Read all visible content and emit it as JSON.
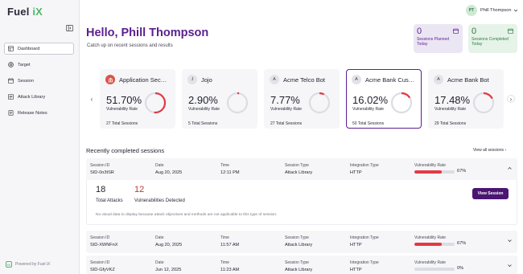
{
  "app": {
    "logo_text": "Fuel",
    "logo_suffix": "iX",
    "powered_by": "Powered by Fuel iX"
  },
  "sidebar": {
    "items": [
      {
        "label": "Dashboard",
        "icon": "dashboard-icon",
        "active": true
      },
      {
        "label": "Target",
        "icon": "target-icon"
      },
      {
        "label": "Session",
        "icon": "calendar-icon"
      },
      {
        "label": "Attack Library",
        "icon": "library-icon"
      },
      {
        "label": "Release Notes",
        "icon": "notes-icon"
      }
    ]
  },
  "user": {
    "initials": "PT",
    "name": "Phill Thompson"
  },
  "header": {
    "greeting": "Hello, Phill Thompson",
    "subtitle": "Catch up on recent sessions and results"
  },
  "stats": {
    "planned": {
      "value": "0",
      "label_line1": "Sessions Planned",
      "label_line2": "Today"
    },
    "completed": {
      "value": "0",
      "label_line1": "Sessions Completed",
      "label_line2": "Today"
    }
  },
  "targets": [
    {
      "name": "Application Securi...",
      "avatar": "bank-icon",
      "rate": "51.70%",
      "rate_value": 51.7,
      "rate_label": "Vulnerability Rate",
      "sessions": "27 Total Sessions",
      "selected": false
    },
    {
      "name": "Jojo",
      "avatar": "J",
      "rate": "2.90%",
      "rate_value": 2.9,
      "rate_label": "Vulnerability Rate",
      "sessions": "5 Total Sessions",
      "selected": false
    },
    {
      "name": "Acme Telco Bot",
      "avatar": "A",
      "rate": "7.77%",
      "rate_value": 7.77,
      "rate_label": "Vulnerability Rate",
      "sessions": "27 Total Sessions",
      "selected": false
    },
    {
      "name": "Acme Bank Custo...",
      "avatar": "A",
      "rate": "16.02%",
      "rate_value": 16.02,
      "rate_label": "Vulnerability Rate",
      "sessions": "50 Total Sessions",
      "selected": true
    },
    {
      "name": "Acme Bank Bot",
      "avatar": "A",
      "rate": "17.48%",
      "rate_value": 17.48,
      "rate_label": "Vulnerability Rate",
      "sessions": "29 Total Sessions",
      "selected": false
    }
  ],
  "recent": {
    "title": "Recently completed sessions",
    "view_all": "View all sessions ›",
    "headers": {
      "id": "Session ID",
      "date": "Date",
      "time": "Time",
      "type": "Session Type",
      "integration": "Integration Type",
      "rate": "Vulnerability Rate"
    },
    "rows": [
      {
        "id": "SID-0n3tSR",
        "date": "Aug 20, 2025",
        "time": "12:11 PM",
        "type": "Attack Library",
        "integration": "HTTP",
        "rate_pct": "67%",
        "rate_value": 67
      },
      {
        "id": "SID-XWNFnX",
        "date": "Aug 20, 2025",
        "time": "11:57 AM",
        "type": "Attack Library",
        "integration": "HTTP",
        "rate_pct": "67%",
        "rate_value": 67
      },
      {
        "id": "SID-GfyVKZ",
        "date": "Jun 12, 2025",
        "time": "11:23 AM",
        "type": "Attack Library",
        "integration": "HTTP",
        "rate_pct": "0%",
        "rate_value": 0
      }
    ],
    "expanded": {
      "attacks_value": "18",
      "attacks_label": "Total Attacks",
      "vulns_value": "12",
      "vulns_label": "Vulnerabilities Detected",
      "no_visual": "No visual data to display because attack objectives and methods are not applicable to this type of session.",
      "view_button": "View Session"
    }
  },
  "colors": {
    "accent": "#5b1f8f",
    "danger": "#e23a45",
    "success": "#2e7d46"
  }
}
